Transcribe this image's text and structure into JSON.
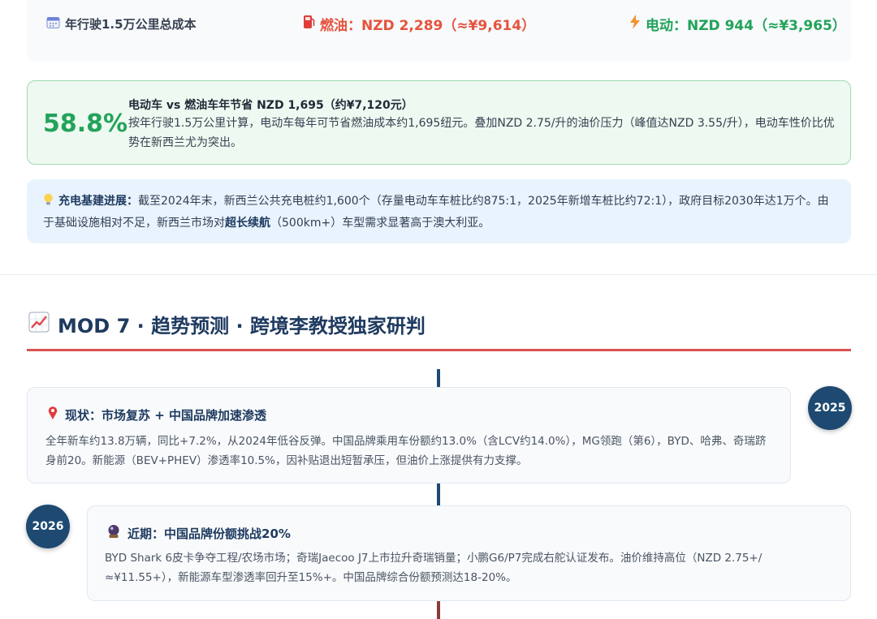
{
  "cost": {
    "label": "年行驶1.5万公里总成本",
    "fuel": "燃油：NZD 2,289（≈¥9,614）",
    "ev": "电动：NZD 944（≈¥3,965）"
  },
  "savings": {
    "percent": "58.8%",
    "title": "电动车 vs 燃油车年节省 NZD 1,695（约¥7,120元）",
    "body": "按年行驶1.5万公里计算，电动车每年可节省燃油成本约1,695纽元。叠加NZD 2.75/升的油价压力（峰值达NZD 3.55/升），电动车性价比优势在新西兰尤为突出。"
  },
  "infra": {
    "label": "充电基建进展：",
    "text1": "截至2024年末，新西兰公共充电桩约1,600个（存量电动车车桩比约875:1，2025年新增车桩比约72:1），政府目标2030年达1万个。由于基础设施相对不足，新西兰市场对",
    "bold": "超长续航",
    "text2": "（500km+）车型需求显著高于澳大利亚。"
  },
  "section": {
    "title": "MOD 7 · 趋势预测 · 跨境李教授独家研判",
    "accent": "#d9534f"
  },
  "timeline": [
    {
      "year": "2025",
      "title": "现状：市场复苏 + 中国品牌加速渗透",
      "body": "全年新车约13.8万辆，同比+7.2%，从2024年低谷反弹。中国品牌乘用车份额约13.0%（含LCV约14.0%），MG领跑（第6），BYD、哈弗、奇瑞跻身前20。新能源（BEV+PHEV）渗透率10.5%，因补贴退出短暂承压，但油价上涨提供有力支撑。"
    },
    {
      "year": "2026",
      "title": "近期：中国品牌份额挑战20%",
      "body": "BYD Shark 6皮卡争夺工程/农场市场；奇瑞Jaecoo J7上市拉升奇瑞销量；小鹏G6/P7完成右舵认证发布。油价维持高位（NZD 2.75+/≈¥11.55+），新能源车型渗透率回升至15%+。中国品牌综合份额预测达18-20%。"
    }
  ]
}
